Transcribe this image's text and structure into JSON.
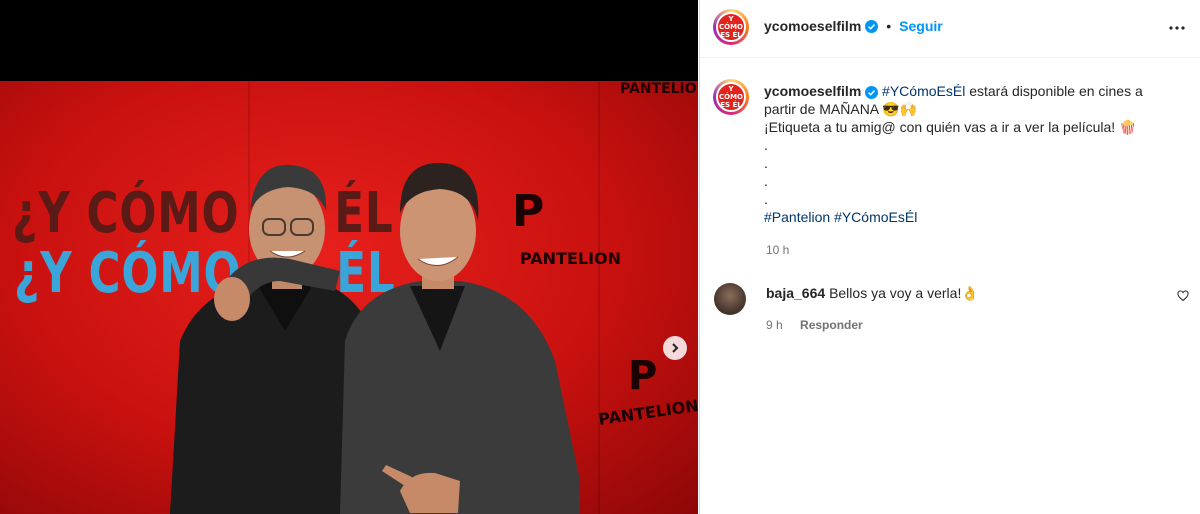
{
  "post": {
    "username": "ycomoeselfilm",
    "follow_label": "Seguir",
    "separator": "•",
    "avatar_text": "Y CÓMO ES ÉL",
    "caption": {
      "hashtag_1": "#YCómoEsÉl",
      "text_1": " estará disponible en cines a partir de MAÑANA 😎🙌",
      "text_2": "¡Etiqueta a tu amig@ con quién vas a ir a ver la película! 🍿",
      "dots": [
        ".",
        ".",
        ".",
        "."
      ],
      "hashtag_2": "#Pantelion",
      "hashtag_3": "#YCómoEsÉl"
    },
    "time_ago": "10 h"
  },
  "photo": {
    "wall_line_1": "¿Y CÓMO ES ÉL",
    "wall_line_2": "¿Y CÓMO ES ÉL",
    "logo_letter": "P",
    "logo_name": "PANTELION"
  },
  "comment": {
    "username": "baja_664",
    "text": "Bellos ya voy a verla!👌",
    "time_ago": "9 h",
    "reply_label": "Responder"
  },
  "colors": {
    "link": "#00376b",
    "follow": "#0095f6",
    "muted": "#737373",
    "verified": "#0095f6"
  },
  "icons": [
    "verified-badge-icon",
    "more-options-icon",
    "carousel-next-icon",
    "heart-icon"
  ]
}
